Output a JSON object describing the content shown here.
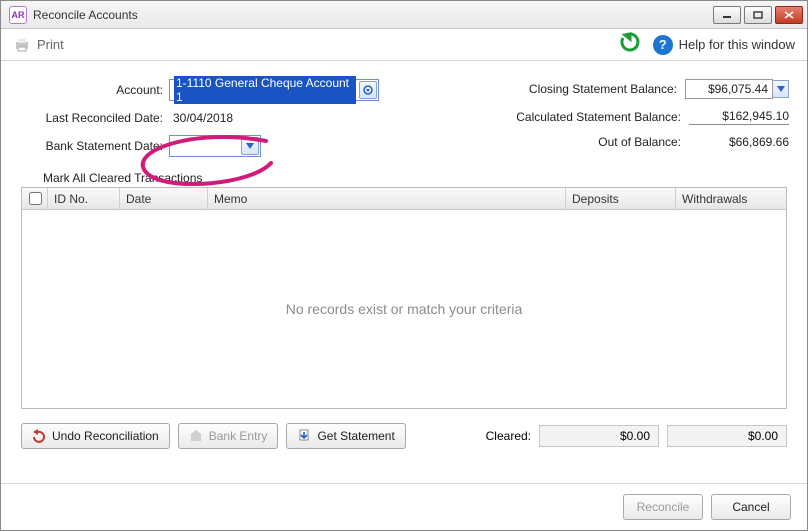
{
  "window": {
    "title": "Reconcile Accounts"
  },
  "toolbar": {
    "print_label": "Print",
    "help_label": "Help for this window"
  },
  "form": {
    "account_label": "Account:",
    "account_value": "1-1110 General Cheque Account 1",
    "last_reconciled_label": "Last Reconciled Date:",
    "last_reconciled_value": "30/04/2018",
    "bank_stmt_date_label": "Bank Statement Date:",
    "bank_stmt_date_value": "",
    "closing_balance_label": "Closing Statement Balance:",
    "closing_balance_value": "$96,075.44",
    "calculated_balance_label": "Calculated Statement Balance:",
    "calculated_balance_value": "$162,945.10",
    "out_of_balance_label": "Out of Balance:",
    "out_of_balance_value": "$66,869.66"
  },
  "grid": {
    "mark_all_label": "Mark All Cleared Transactions",
    "columns": {
      "id": "ID No.",
      "date": "Date",
      "memo": "Memo",
      "deposits": "Deposits",
      "withdrawals": "Withdrawals"
    },
    "empty_message": "No records exist or match your criteria",
    "rows": []
  },
  "buttons": {
    "undo": "Undo Reconciliation",
    "bank_entry": "Bank Entry",
    "get_statement": "Get Statement",
    "reconcile": "Reconcile",
    "cancel": "Cancel"
  },
  "cleared": {
    "label": "Cleared:",
    "deposits": "$0.00",
    "withdrawals": "$0.00"
  },
  "colors": {
    "accent": "#1a54c4",
    "annotation": "#d11a7a"
  }
}
